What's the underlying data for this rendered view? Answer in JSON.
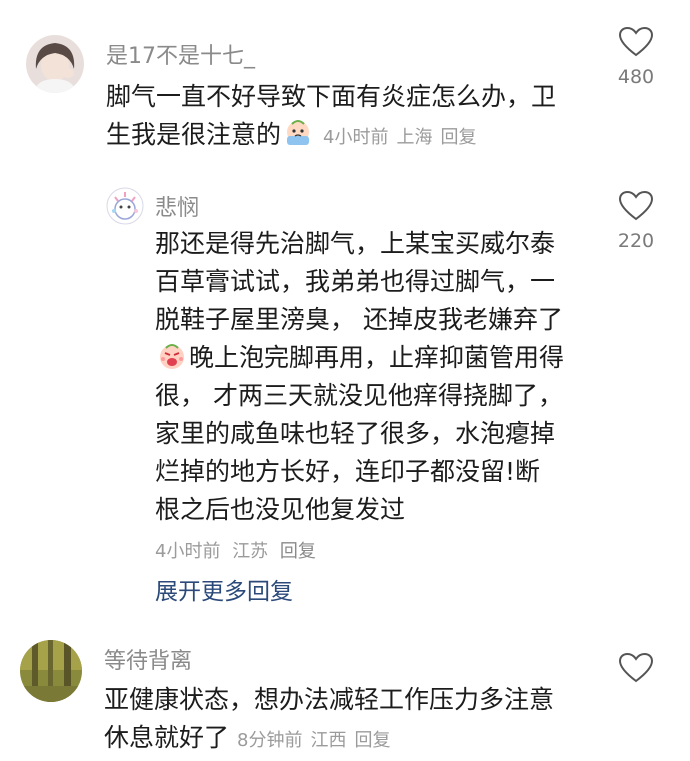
{
  "comments": [
    {
      "username": "是17不是十七_",
      "text": "脚气一直不好导致下面有炎症怎么办，卫生我是很注意的",
      "emoji": "crying-emoji",
      "time": "4小时前",
      "location": "上海",
      "reply_label": "回复",
      "likes": "480",
      "replies": [
        {
          "username": "悲悯",
          "text_before_emoji": "那还是得先治脚气，上某宝买威尔泰百草膏试试，我弟弟也得过脚气，一脱鞋子屋里滂臭， 还掉皮我老嫌弃了",
          "emoji": "angry-emoji",
          "text_after_emoji": "晚上泡完脚再用，止痒抑菌管用得很， 才两三天就没见他痒得挠脚了，家里的咸鱼味也轻了很多，水泡瘪掉烂掉的地方长好，连印子都没留!断根之后也没见他复发过",
          "time": "4小时前",
          "location": "江苏",
          "reply_label": "回复",
          "likes": "220"
        }
      ],
      "expand_label": "展开更多回复"
    },
    {
      "username": "等待背离",
      "text": "亚健康状态，想办法减轻工作压力多注意休息就好了",
      "time": "8分钟前",
      "location": "江西",
      "reply_label": "回复",
      "likes": ""
    }
  ],
  "colors": {
    "username": "#8a8a8a",
    "body_text": "#1c1c1c",
    "meta": "#9b9b9b",
    "link": "#2b4a7a"
  }
}
